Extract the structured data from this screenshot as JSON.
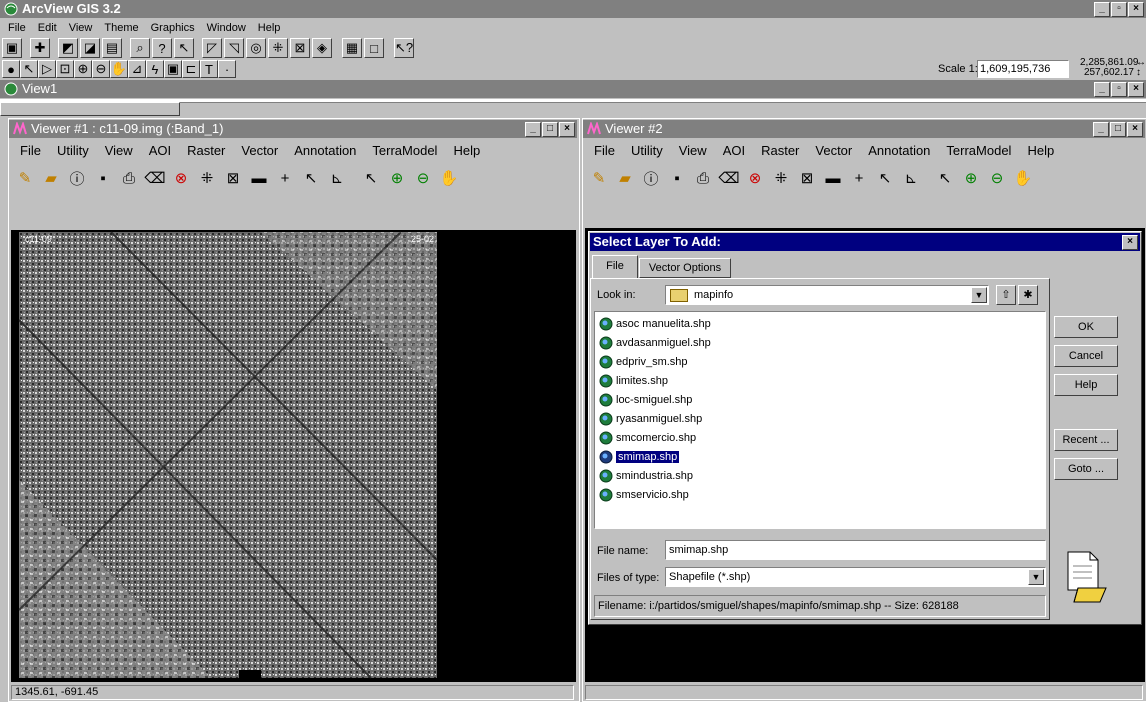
{
  "app": {
    "title": "ArcView GIS 3.2",
    "menu": [
      "File",
      "Edit",
      "View",
      "Theme",
      "Graphics",
      "Window",
      "Help"
    ],
    "scale_label": "Scale 1:",
    "scale_value": "1,609,195,736",
    "coord_x": "2,285,861.09",
    "coord_y": "257,602.17"
  },
  "view1": {
    "title": "View1"
  },
  "viewer1": {
    "title": "Viewer #1 : c11-09.img (:Band_1)",
    "menu": [
      "File",
      "Utility",
      "View",
      "AOI",
      "Raster",
      "Vector",
      "Annotation",
      "TerraModel",
      "Help"
    ],
    "image_label_left": "c11-09",
    "image_label_right": "25-02",
    "status": "1345.61, -691.45"
  },
  "viewer2": {
    "title": "Viewer #2",
    "menu": [
      "File",
      "Utility",
      "View",
      "AOI",
      "Raster",
      "Vector",
      "Annotation",
      "TerraModel",
      "Help"
    ]
  },
  "dialog": {
    "title": "Select Layer To Add:",
    "tabs": [
      "File",
      "Vector Options"
    ],
    "look_in_label": "Look in:",
    "look_in_value": "mapinfo",
    "files": [
      "asoc manuelita.shp",
      "avdasanmiguel.shp",
      "edpriv_sm.shp",
      "limites.shp",
      "loc-smiguel.shp",
      "ryasanmiguel.shp",
      "smcomercio.shp",
      "smimap.shp",
      "smindustria.shp",
      "smservicio.shp"
    ],
    "selected_index": 7,
    "buttons": {
      "ok": "OK",
      "cancel": "Cancel",
      "help": "Help",
      "recent": "Recent ...",
      "goto": "Goto ..."
    },
    "file_name_label": "File name:",
    "file_name_value": "smimap.shp",
    "file_type_label": "Files of type:",
    "file_type_value": "Shapefile (*.shp)",
    "info": "Filename: i:/partidos/smiguel/shapes/mapinfo/smimap.shp -- Size: 628188"
  },
  "colors": {
    "active_title": "#000080",
    "inactive_title": "#808080",
    "face": "#c0c0c0"
  }
}
